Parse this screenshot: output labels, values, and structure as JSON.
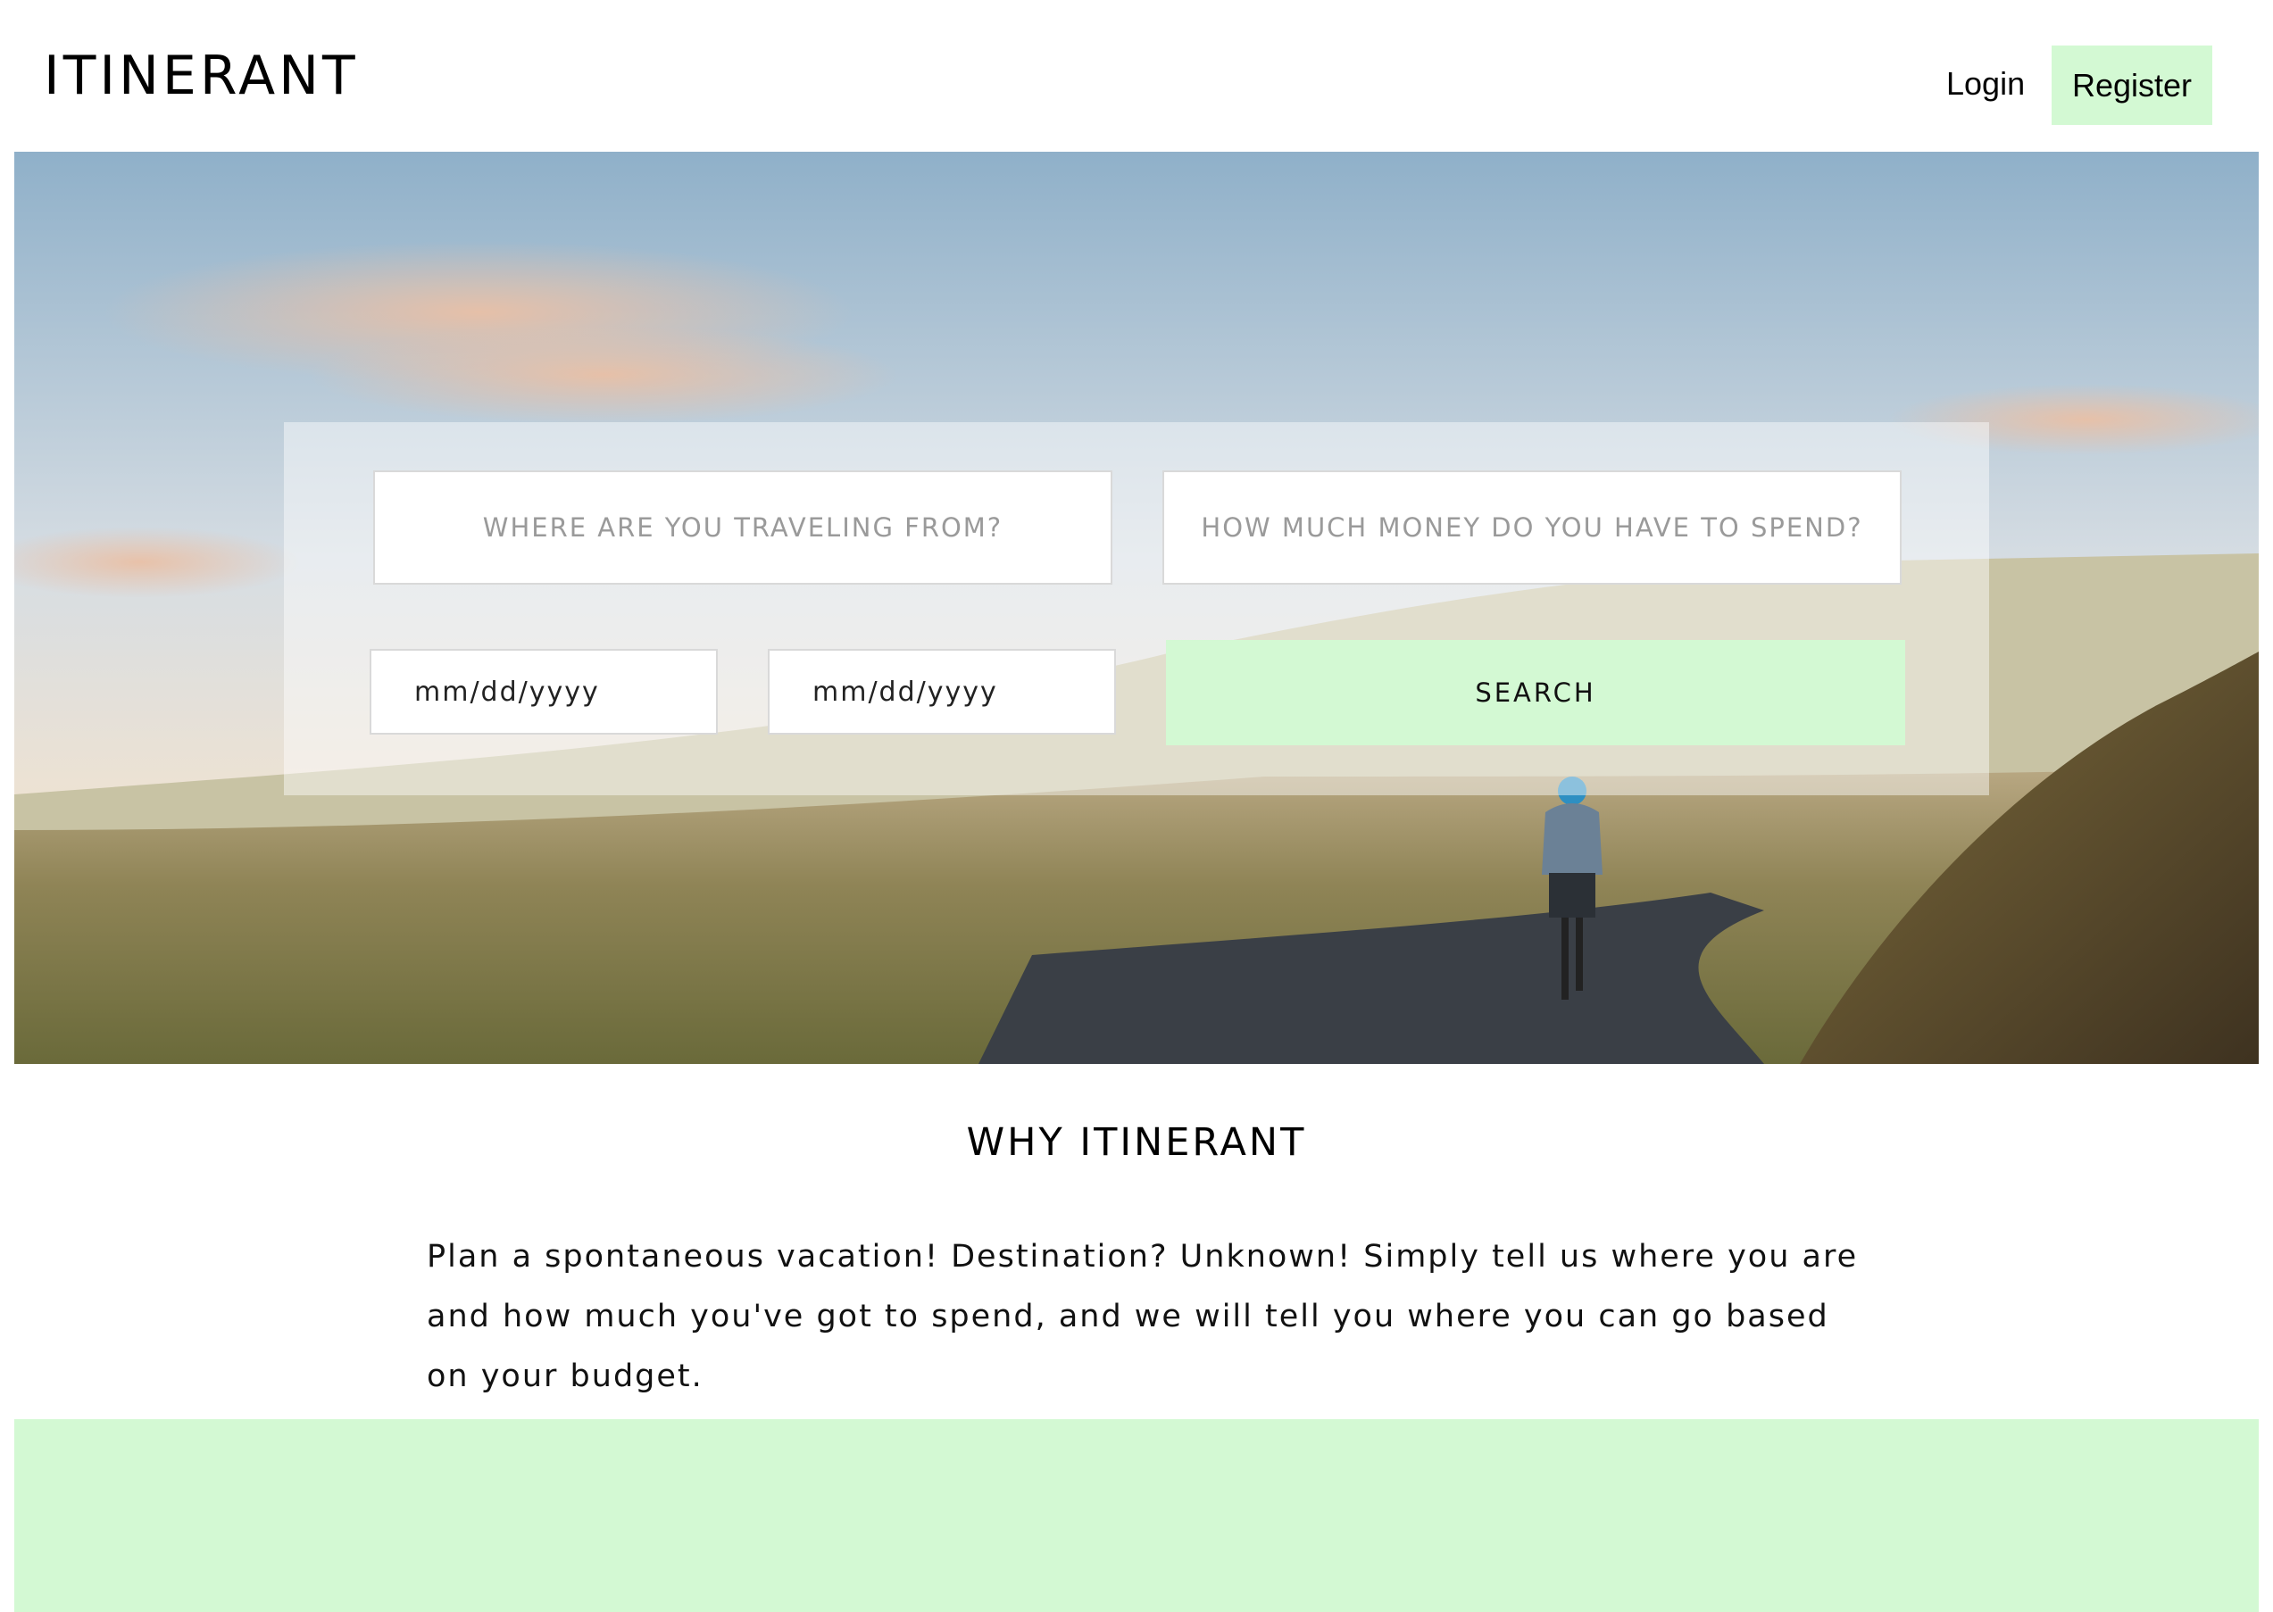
{
  "colors": {
    "accent": "#d3f9d3",
    "panel_border": "#d9d9d9",
    "sky_top": "#8fb0c9",
    "sky_bottom": "#f3e3cf"
  },
  "header": {
    "logo": "ITINERANT",
    "login_label": "Login",
    "register_label": "Register"
  },
  "search": {
    "from_placeholder": "WHERE ARE YOU TRAVELING FROM?",
    "budget_placeholder": "HOW MUCH MONEY DO YOU HAVE TO SPEND?",
    "start_date_placeholder": "mm/dd/yyyy",
    "end_date_placeholder": "mm/dd/yyyy",
    "button_label": "SEARCH"
  },
  "hero": {
    "image": "cyclist-on-mountain-road"
  },
  "why": {
    "title": "WHY ITINERANT",
    "text": "Plan a spontaneous vacation! Destination? Unknown! Simply tell us where you are and how much you've got to spend, and we will tell you where you can go based on your budget."
  }
}
